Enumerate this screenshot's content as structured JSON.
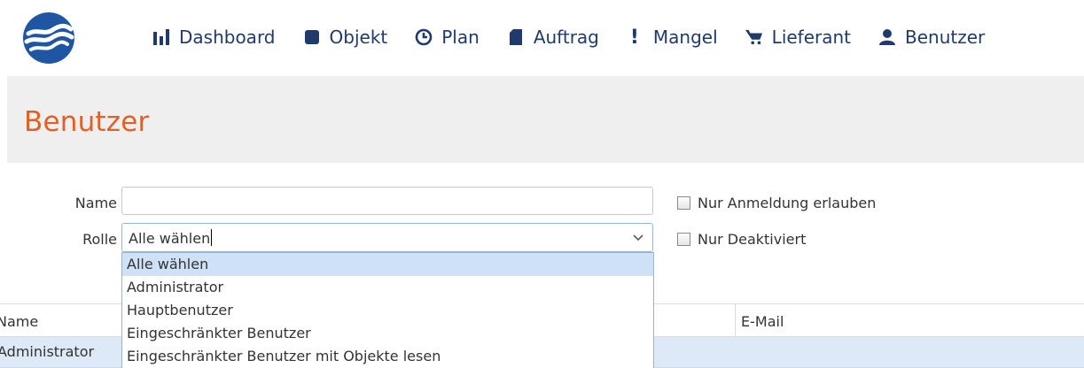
{
  "nav": {
    "items": [
      {
        "label": "Dashboard",
        "icon": "bar-chart-icon"
      },
      {
        "label": "Objekt",
        "icon": "square-icon"
      },
      {
        "label": "Plan",
        "icon": "clock-icon"
      },
      {
        "label": "Auftrag",
        "icon": "document-icon"
      },
      {
        "label": "Mangel",
        "icon": "exclamation-icon"
      },
      {
        "label": "Lieferant",
        "icon": "cart-icon"
      },
      {
        "label": "Benutzer",
        "icon": "user-icon"
      }
    ]
  },
  "page": {
    "title": "Benutzer"
  },
  "form": {
    "name_label": "Name",
    "name_value": "",
    "rolle_label": "Rolle",
    "rolle_value": "Alle wählen",
    "checkbox_login_label": "Nur Anmeldung erlauben",
    "checkbox_login_checked": false,
    "checkbox_deactivated_label": "Nur Deaktiviert",
    "checkbox_deactivated_checked": false
  },
  "dropdown": {
    "options": [
      "Alle wählen",
      "Administrator",
      "Hauptbenutzer",
      "Eingeschränkter Benutzer",
      "Eingeschränkter Benutzer mit Objekte lesen"
    ],
    "selected_index": 0
  },
  "table": {
    "columns": [
      "Name",
      "E-Mail"
    ],
    "rows": [
      {
        "name": "Administrator",
        "email": ""
      }
    ]
  },
  "colors": {
    "brand": "#1f3a6b",
    "title": "#e0602a",
    "selected_row": "#dde9f7"
  }
}
